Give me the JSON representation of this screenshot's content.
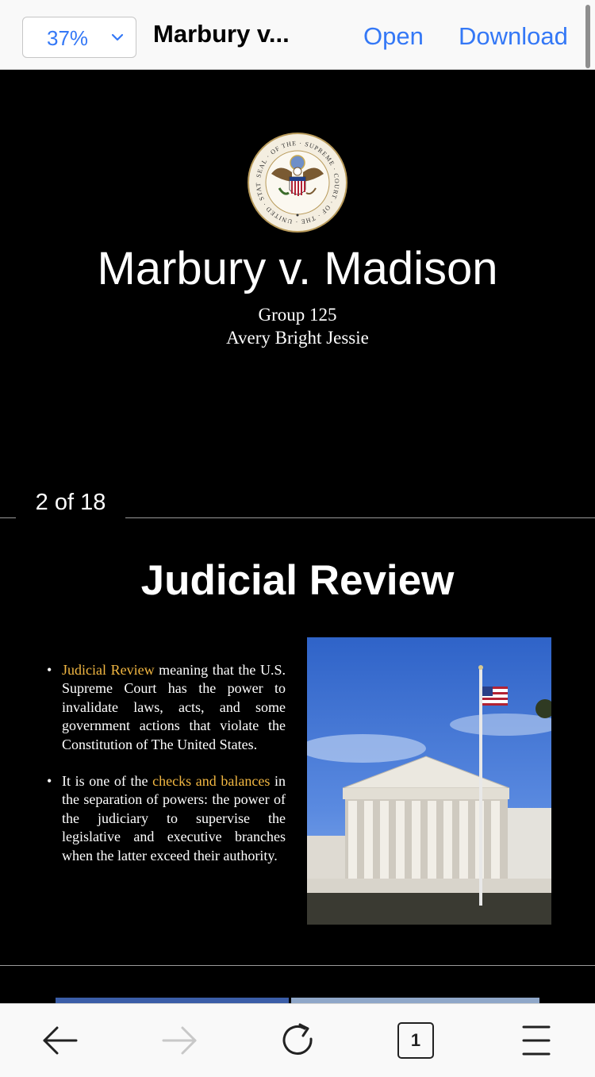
{
  "toolbar": {
    "zoom": "37%",
    "title": "Marbury v...",
    "open_label": "Open",
    "download_label": "Download"
  },
  "slides": {
    "slide1": {
      "title": "Marbury v. Madison",
      "subtitle_line1": "Group 125",
      "subtitle_line2": "Avery Bright Jessie",
      "seal_text": "SEAL OF THE SUPREME COURT OF THE UNITED STATES"
    },
    "page_indicator": "2 of 18",
    "slide2": {
      "title": "Judicial Review",
      "bullet1_highlight": "Judicial Review",
      "bullet1_text": " meaning that the U.S. Supreme Court has the power to invalidate laws, acts, and some government actions that violate the Constitution of The United States.",
      "bullet2_pre": "It is one of the ",
      "bullet2_highlight": "checks and balances",
      "bullet2_text": " in the separation of powers: the power of the judiciary to supervise the legislative and executive branches when the latter exceed their authority."
    }
  },
  "bottombar": {
    "tab_count": "1"
  },
  "colors": {
    "accent": "#3478f6",
    "highlight": "#f2b742",
    "background": "#000000"
  },
  "icons": [
    "chevron-down-icon",
    "back-arrow-icon",
    "forward-arrow-icon",
    "reload-icon",
    "tabs-icon",
    "menu-icon"
  ]
}
